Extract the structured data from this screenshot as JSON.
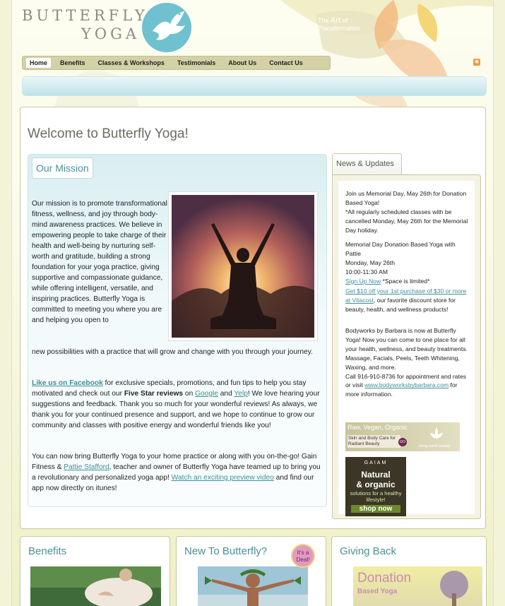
{
  "brand": {
    "logo_line1": "BUTTERFLY",
    "logo_line2": "YOGA",
    "tagline_pre": "The",
    "tagline_art": "Art",
    "tagline_post": "of",
    "tagline_line2": "Transformation"
  },
  "nav": {
    "items": [
      {
        "label": "Home",
        "active": true
      },
      {
        "label": "Benefits"
      },
      {
        "label": "Classes & Workshops"
      },
      {
        "label": "Testimonials"
      },
      {
        "label": "About Us"
      },
      {
        "label": "Contact Us"
      }
    ],
    "rss_icon": "rss-icon"
  },
  "page": {
    "title": "Welcome to Butterfly Yoga!"
  },
  "mission": {
    "heading": "Our Mission",
    "p1": "Our mission is to promote transformational fitness, wellness, and joy through body-mind awareness practices. We believe in empowering people to take charge of their health and well-being by nurturing self-worth and gratitude, building a strong foundation for your yoga practice, giving supportive and compassionate guidance, while offering intelligent, versatile, and inspiring practices. Butterfly Yoga is committed to meeting you where you are and helping you open to",
    "p1_rest": "new possibilities with a practice that will grow and change with you through your journey.",
    "p2_link_facebook": "Like us on Facebook",
    "p2_a": " for exclusive specials, promotions, and fun tips to help you stay motivated and check out our ",
    "p2_bold": "Five Star reviews",
    "p2_b": " on ",
    "p2_link_google": "Google",
    "p2_c": " and ",
    "p2_link_yelp": "Yelp",
    "p2_d": "! We love hearing your suggestions and feedback. Thank you so much for your wonderful reviews! As always, we thank you for your continued presence and support, and we hope to continue to grow our community and classes with positive energy and wonderful friends like you!",
    "p3_a": "You can now bring Butterfly Yoga to your home practice or along with you on-the-go! Gain Fitness & ",
    "p3_link_pattie": "Pattie Stafford",
    "p3_b": ", teacher and owner of Butterfly Yoga have teamed up to bring you a revolutionary and personalized yoga app! ",
    "p3_link_video": "Watch an exciting preview video",
    "p3_c": " and find our app now directly on itunes!"
  },
  "news": {
    "tab": "News & Updates",
    "n1": "Join us Memorial Day, May 26th for Donation Based Yoga!\n*All regularly scheduled classes with be cancelled Monday, May 26th for the Memorial Day holiday.",
    "n2": "Memorial Day Donation Based Yoga with Pattie\nMonday, May 26th\n10:00-11:30 AM",
    "n2_link": "Sign Up Now",
    "n2_after": " *Space is limited*",
    "n3_link": "Get $10 off your 1st purchase of $30 or more at Vitacost",
    "n3_after": ", our favorite discount store for beauty, health, and wellness products!",
    "n4": "Bodyworks by Barbara is now at Butterfly Yoga! Now you can come to one place for all your health, wellness, and beauty treatments. Massage, Facials, Peels, Teeth Whitening, Waxing, and more.\nCall 916-910-8736 for appointment and rates or visit ",
    "n4_link": "www.bodyworksbybarbara.com",
    "n4_after": " for more information.",
    "ad1_title": "Raw, Vegan, Organic",
    "ad1_sub": "Skin and Body Care for Radiant Beauty",
    "ad1_badge": "GO",
    "ad1_brand": "living earth beauty",
    "ad2_brand": "GAIAM",
    "ad2_line1": "Natural",
    "ad2_line2": "& organic",
    "ad2_line3": "solutions for a healthy lifestyle!",
    "ad2_cta": "shop now"
  },
  "bottom": {
    "benefits": "Benefits",
    "new_to": "New To Butterfly?",
    "deal": "It's a Deal!",
    "giving": "Giving Back",
    "donation_line1": "Donation",
    "donation_line2": "Based Yoga"
  },
  "colors": {
    "accent": "#4c8f97",
    "link": "#3f8e98",
    "nav_bg": "#d4d1a6"
  }
}
